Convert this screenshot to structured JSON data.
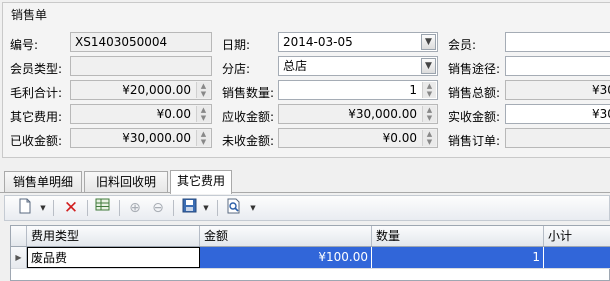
{
  "group": {
    "title": "销售单"
  },
  "form": {
    "order_no_label": "编号:",
    "order_no": "XS1403050004",
    "date_label": "日期:",
    "date": "2014-03-05",
    "member_label": "会员:",
    "member": "",
    "member_type_label": "会员类型:",
    "member_type": "",
    "branch_label": "分店:",
    "branch": "总店",
    "channel_label": "销售途径:",
    "channel": "",
    "gross_profit_label": "毛利合计:",
    "gross_profit": "¥20,000.00",
    "sale_qty_label": "销售数量:",
    "sale_qty": "1",
    "sale_total_label": "销售总额:",
    "sale_total": "¥30",
    "other_fee_label": "其它费用:",
    "other_fee": "¥0.00",
    "receivable_label": "应收金额:",
    "receivable": "¥30,000.00",
    "actual_received_label": "实收金额:",
    "actual_received": "¥30",
    "received_label": "已收金额:",
    "received": "¥30,000.00",
    "unreceived_label": "未收金额:",
    "unreceived": "¥0.00",
    "sales_order_label": "销售订单:",
    "sales_order": ""
  },
  "tabs": [
    {
      "label": "销售单明细"
    },
    {
      "label": "旧料回收明细"
    },
    {
      "label": "其它费用"
    }
  ],
  "toolbar": {
    "new_icon": "new-document-icon",
    "delete_icon": "delete-x-icon",
    "table_icon": "table-icon",
    "up_icon": "move-up-icon",
    "down_icon": "move-down-icon",
    "save_icon": "save-disk-icon",
    "preview_icon": "print-preview-icon"
  },
  "grid": {
    "columns": [
      "费用类型",
      "金额",
      "数量",
      "小计"
    ],
    "rows": [
      {
        "fee_type": "废品费",
        "amount": "¥100.00",
        "qty": "1",
        "subtotal": ""
      }
    ]
  },
  "colors": {
    "selection": "#3166d9",
    "delete_red": "#d21f1f"
  }
}
